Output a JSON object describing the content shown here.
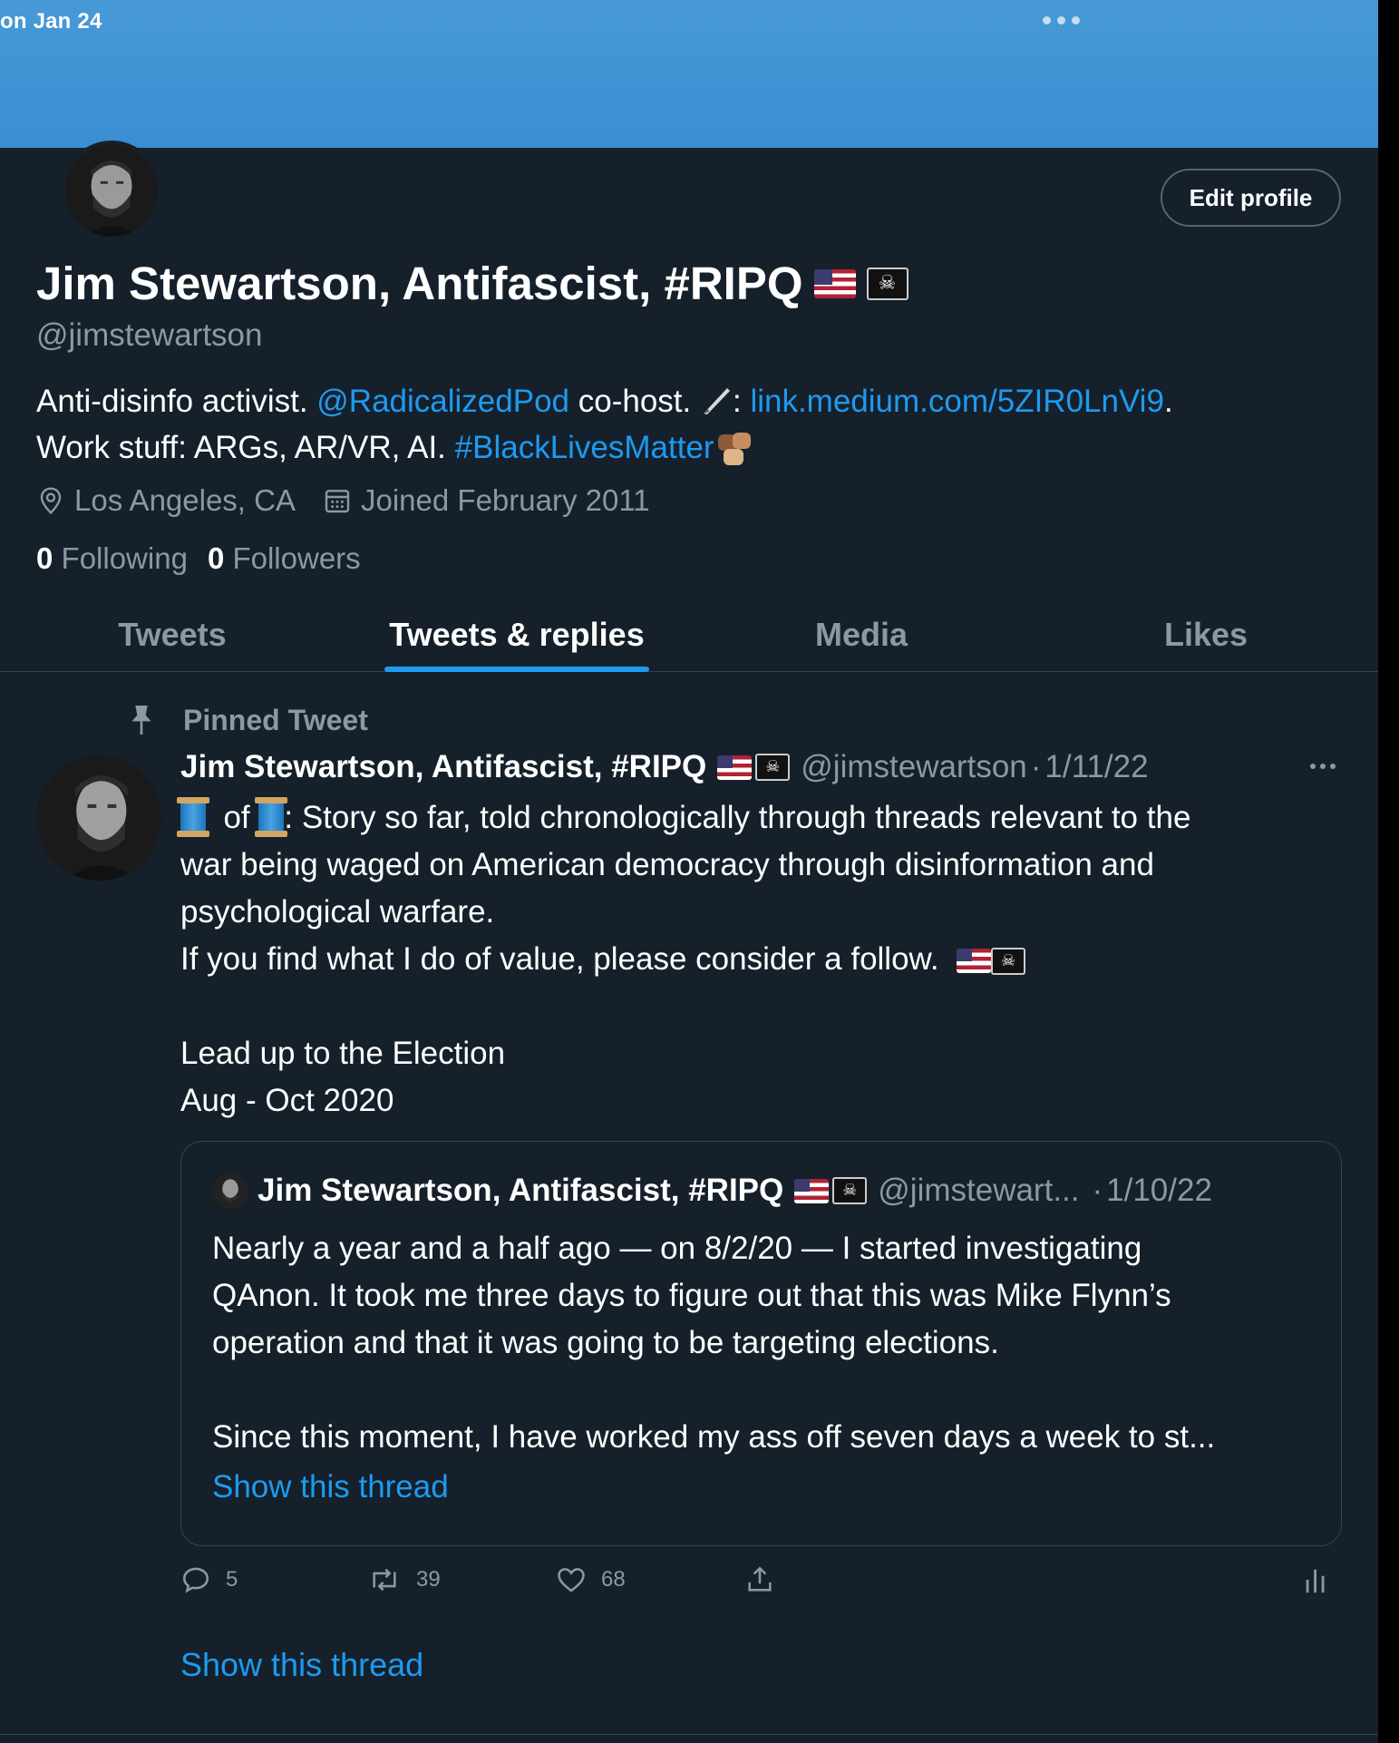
{
  "banner": {
    "date_fragment": "on Jan 24"
  },
  "profile": {
    "edit_label": "Edit profile",
    "display_name": "Jim Stewartson, Antifascist, #RIPQ",
    "handle": "@jimstewartson",
    "bio": {
      "text1": "Anti-disinfo activist. ",
      "mention": "@RadicalizedPod",
      "text2": " co-host. ",
      "text3": ": ",
      "url": "link.medium.com/5ZIR0LnVi9",
      "text4": ".",
      "line2_text": "Work stuff: ARGs, AR/VR, AI. ",
      "hashtag": "#BlackLivesMatter"
    },
    "location": "Los Angeles, CA",
    "joined": "Joined February 2011",
    "following_count": "0",
    "following_label": "Following",
    "followers_count": "0",
    "followers_label": "Followers"
  },
  "tabs": [
    "Tweets",
    "Tweets & replies",
    "Media",
    "Likes"
  ],
  "active_tab": 1,
  "tweet": {
    "pinned_label": "Pinned Tweet",
    "name": "Jim Stewartson, Antifascist, #RIPQ",
    "handle": "@jimstewartson",
    "separator": "·",
    "date": "1/11/22",
    "line1_of": "of",
    "line1_rest": ": Story so far, told chronologically through threads relevant to the",
    "line2": "war being waged on American democracy through disinformation and",
    "line3": "psychological warfare.",
    "line4": "If you find what I do of value, please consider a follow.",
    "line5": "Lead up to the Election",
    "line6": "Aug - Oct 2020",
    "quote": {
      "name": "Jim Stewartson, Antifascist, #RIPQ",
      "handle": "@jimstewart...",
      "separator": "·",
      "date": "1/10/22",
      "line1": "Nearly a year and a half ago — on 8/2/20 — I started investigating",
      "line2": "QAnon. It took me three days to figure out that this was Mike Flynn’s",
      "line3": "operation and that it was going to be targeting elections.",
      "line4": "Since this moment, I have worked my ass off seven days a week to st...",
      "show_thread": "Show this thread"
    },
    "replies": "5",
    "retweets": "39",
    "likes": "68",
    "show_thread": "Show this thread"
  },
  "colors": {
    "background": "#15202b",
    "banner": "#3b8ed1",
    "accent": "#1d9bf0",
    "muted": "#8b98a5",
    "border": "#38444d"
  },
  "icons": [
    "more-dots-icon",
    "location-pin-icon",
    "calendar-icon",
    "pin-icon",
    "reply-icon",
    "retweet-icon",
    "like-icon",
    "share-icon",
    "analytics-icon",
    "feather-pen-icon",
    "us-flag-icon",
    "pirate-flag-icon",
    "thread-spool-icon",
    "raised-fists-icon"
  ]
}
